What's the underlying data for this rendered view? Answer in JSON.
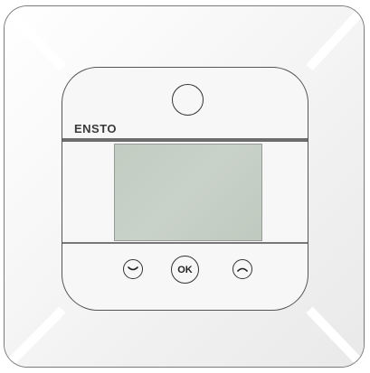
{
  "device": {
    "brand": "ENSTO",
    "ok_label": "OK"
  },
  "colors": {
    "plate": "#f3f3f3",
    "display": "#c5cec4",
    "outline": "#555555"
  },
  "icons": {
    "down": "chevron-down-icon",
    "up": "chevron-up-icon",
    "sensor": "sensor-icon"
  }
}
